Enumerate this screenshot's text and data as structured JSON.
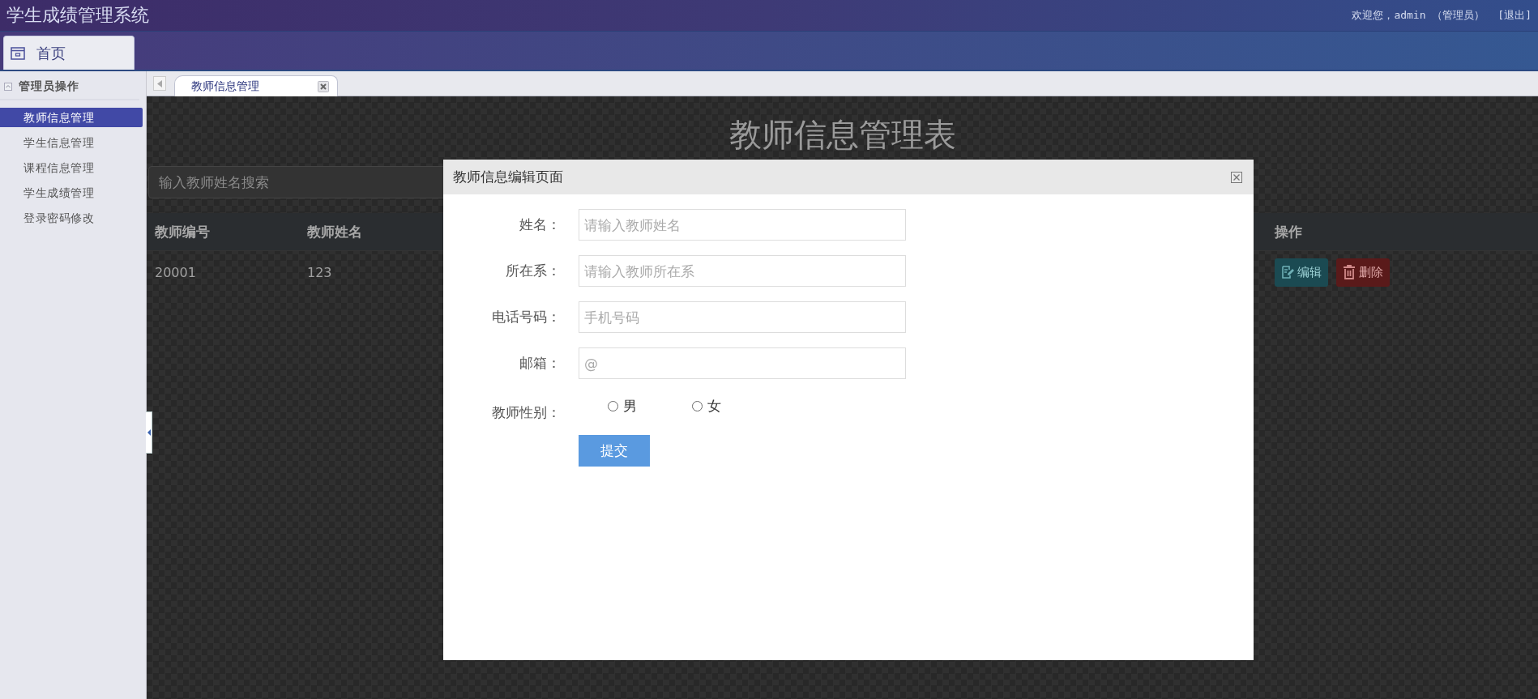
{
  "header": {
    "title": "学生成绩管理系统",
    "welcome": "欢迎您，admin （管理员）",
    "logout": "[退出]"
  },
  "nav_tabs": [
    {
      "label": "首页",
      "selected": true
    }
  ],
  "sidebar": {
    "group": {
      "title": "管理员操作",
      "expanded": true,
      "items": [
        {
          "label": "教师信息管理",
          "selected": true
        },
        {
          "label": "学生信息管理",
          "selected": false
        },
        {
          "label": "课程信息管理",
          "selected": false
        },
        {
          "label": "学生成绩管理",
          "selected": false
        },
        {
          "label": "登录密码修改",
          "selected": false
        }
      ]
    }
  },
  "content_tabs": [
    {
      "label": "教师信息管理",
      "selected": true
    }
  ],
  "page": {
    "title": "教师信息管理表",
    "search": {
      "placeholder": "输入教师姓名搜索"
    },
    "table": {
      "columns": [
        "教师编号",
        "教师姓名",
        "操作"
      ],
      "rows": [
        {
          "cells": [
            "20001",
            "123"
          ],
          "actions": [
            {
              "kind": "edit",
              "label": "编辑"
            },
            {
              "kind": "delete",
              "label": "删除"
            }
          ]
        }
      ]
    }
  },
  "dialog": {
    "title": "教师信息编辑页面",
    "fields": [
      {
        "label": "姓名：",
        "placeholder": "请输入教师姓名"
      },
      {
        "label": "所在系：",
        "placeholder": "请输入教师所在系"
      },
      {
        "label": "电话号码：",
        "placeholder": "手机号码"
      },
      {
        "label": "邮箱：",
        "placeholder": "@"
      }
    ],
    "gender": {
      "label": "教师性别：",
      "options": [
        {
          "label": "男",
          "selected": false
        },
        {
          "label": "女",
          "selected": false
        }
      ]
    },
    "submit": "提交"
  }
}
